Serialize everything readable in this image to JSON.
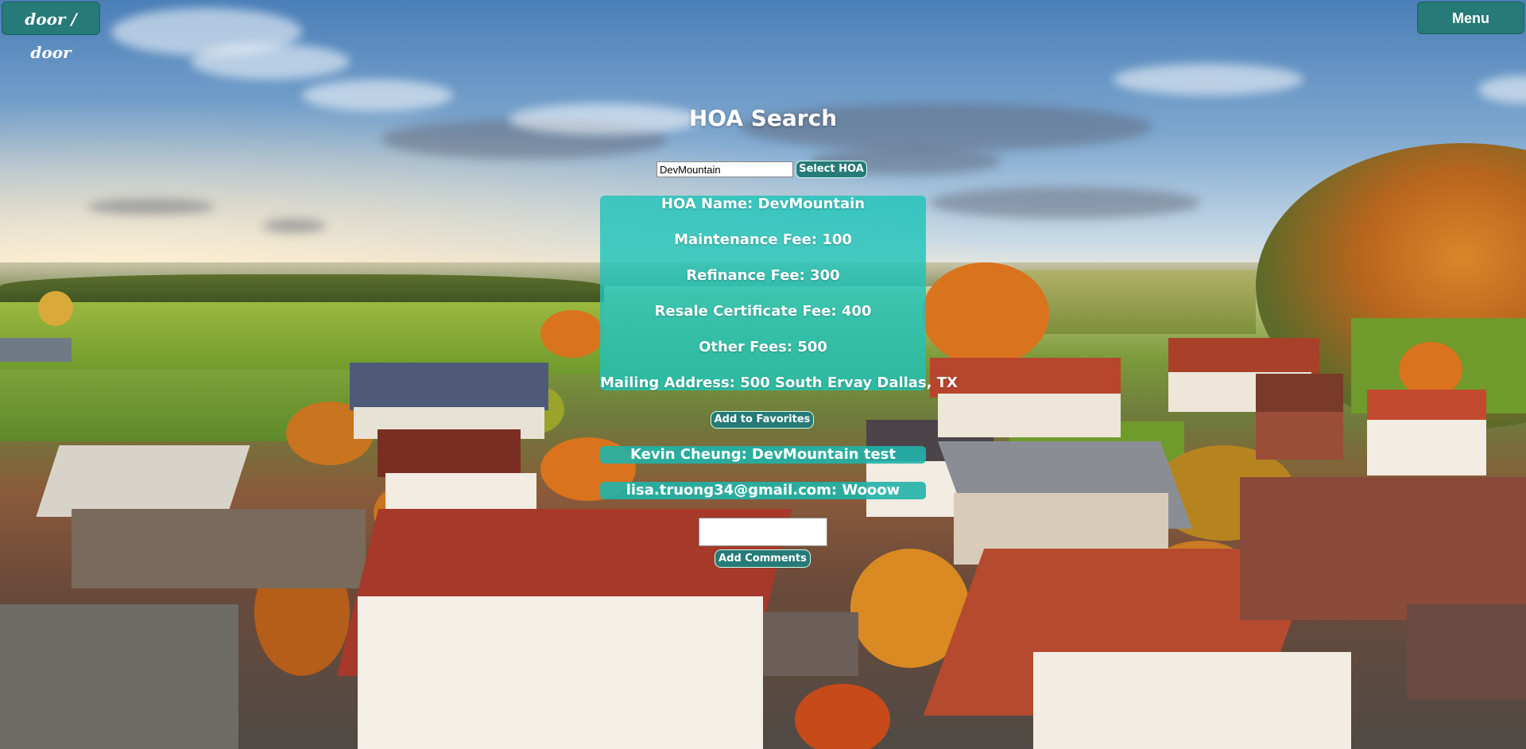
{
  "header": {
    "logo_text": "door / door",
    "menu_label": "Menu"
  },
  "main": {
    "title": "HOA Search",
    "search": {
      "value": "DevMountain",
      "placeholder": ""
    },
    "select_button_label": "Select HOA",
    "hoa_details": {
      "name": "HOA Name: DevMountain",
      "maintenance_fee": "Maintenance Fee: 100",
      "refinance_fee": "Refinance Fee: 300",
      "resale_certificate_fee": "Resale Certificate Fee: 400",
      "other_fees": "Other Fees: 500",
      "mailing_address": "Mailing Address: 500 South Ervay Dallas, TX"
    },
    "favorites_button_label": "Add to Favorites",
    "comments": [
      "Kevin Cheung: DevMountain test",
      "lisa.truong34@gmail.com: Wooow"
    ],
    "comment_input": {
      "value": ""
    },
    "add_comments_button_label": "Add Comments"
  },
  "theme": {
    "accent": "#267a78",
    "card": "#20c3b9"
  },
  "background": "village-landscape"
}
